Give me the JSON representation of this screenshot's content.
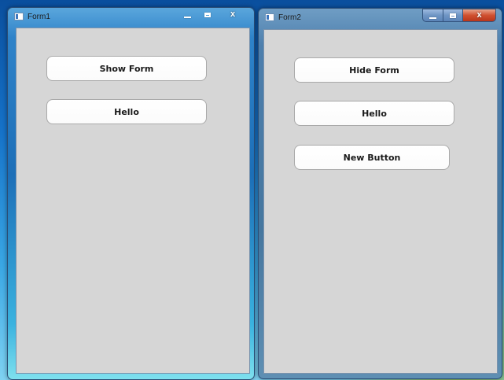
{
  "windows": [
    {
      "title": "Form1",
      "state": "active",
      "caption": {
        "minimize": "–",
        "maximize": "□",
        "close": "x"
      },
      "buttons": [
        {
          "label": "Show Form"
        },
        {
          "label": "Hello"
        }
      ]
    },
    {
      "title": "Form2",
      "state": "inactive",
      "caption": {
        "minimize": "–",
        "maximize": "□",
        "close": "x"
      },
      "buttons": [
        {
          "label": "Hide Form"
        },
        {
          "label": "Hello"
        },
        {
          "label": "New Button"
        }
      ]
    }
  ],
  "colors": {
    "client_background": "#d6d6d6",
    "button_background": "#ffffff",
    "close_button": "#c9452a"
  }
}
